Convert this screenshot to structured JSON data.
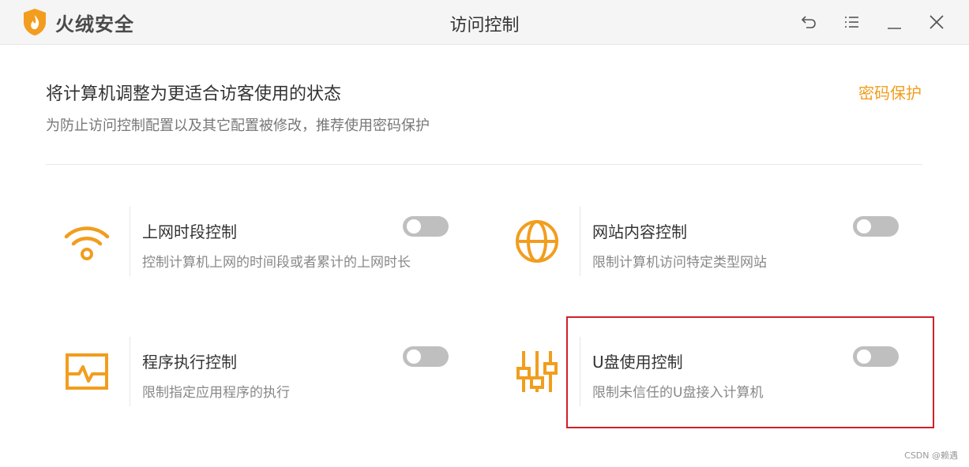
{
  "app": {
    "brand": "火绒安全",
    "window_title": "访问控制"
  },
  "header": {
    "title": "将计算机调整为更适合访客使用的状态",
    "subtitle": "为防止访问控制配置以及其它配置被修改，推荐使用密码保护",
    "password_link": "密码保护"
  },
  "cards": [
    {
      "title": "上网时段控制",
      "desc": "控制计算机上网的时间段或者累计的上网时长",
      "icon": "wifi-icon",
      "enabled": false
    },
    {
      "title": "网站内容控制",
      "desc": "限制计算机访问特定类型网站",
      "icon": "globe-icon",
      "enabled": false
    },
    {
      "title": "程序执行控制",
      "desc": "限制指定应用程序的执行",
      "icon": "monitor-pulse-icon",
      "enabled": false
    },
    {
      "title": "U盘使用控制",
      "desc": "限制未信任的U盘接入计算机",
      "icon": "sliders-icon",
      "enabled": false
    }
  ],
  "watermark": "CSDN @赖遇",
  "colors": {
    "accent": "#f29d1e",
    "highlight": "#d0202a",
    "toggle_off": "#bfbfbf"
  }
}
